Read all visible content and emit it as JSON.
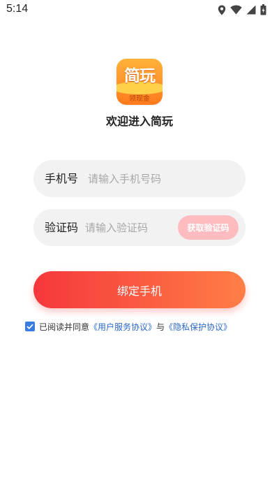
{
  "status_bar": {
    "time": "5:14",
    "icons": [
      "location-icon",
      "wifi-icon",
      "signal-icon",
      "battery-icon"
    ]
  },
  "logo": {
    "title": "简玩",
    "subtitle": "领现金"
  },
  "welcome_text": "欢迎进入简玩",
  "phone_field": {
    "label": "手机号",
    "placeholder": "请输入手机号码",
    "value": ""
  },
  "code_field": {
    "label": "验证码",
    "placeholder": "请输入验证码",
    "value": "",
    "get_code_label": "获取验证码"
  },
  "bind_button_label": "绑定手机",
  "agreement": {
    "checked": true,
    "prefix": "已阅读并同意",
    "user_agreement": "《用户服务协议》",
    "conjunction": "与",
    "privacy_policy": "《隐私保护协议》"
  },
  "colors": {
    "primary_gradient_start": "#f5373c",
    "primary_gradient_end": "#ff7e46",
    "get_code_disabled": "#ffbcc0",
    "link": "#2e68c8",
    "checkbox": "#3a7ce0",
    "field_background": "#f2f2f2"
  }
}
